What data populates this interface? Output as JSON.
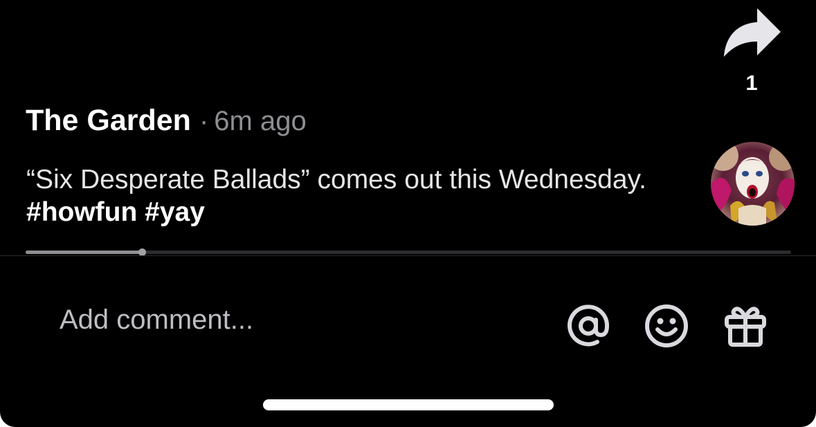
{
  "share": {
    "icon": "share-arrow-icon",
    "count": "1"
  },
  "post": {
    "username": "The Garden",
    "separator": "·",
    "timestamp": "6m ago",
    "caption_text": "“Six Desperate Ballads” comes out this Wednesday.",
    "hashtags": [
      "#howfun",
      "#yay"
    ],
    "avatar_icon": "profile-avatar"
  },
  "playback": {
    "progress": 0.152
  },
  "comment_bar": {
    "placeholder": "Add comment...",
    "icons": [
      "at-mention-icon",
      "emoji-icon",
      "gift-icon"
    ]
  },
  "colors": {
    "background": "#000000",
    "primary_text": "#ffffff",
    "secondary_text": "#8e8e93",
    "icon": "#d9d9de"
  }
}
